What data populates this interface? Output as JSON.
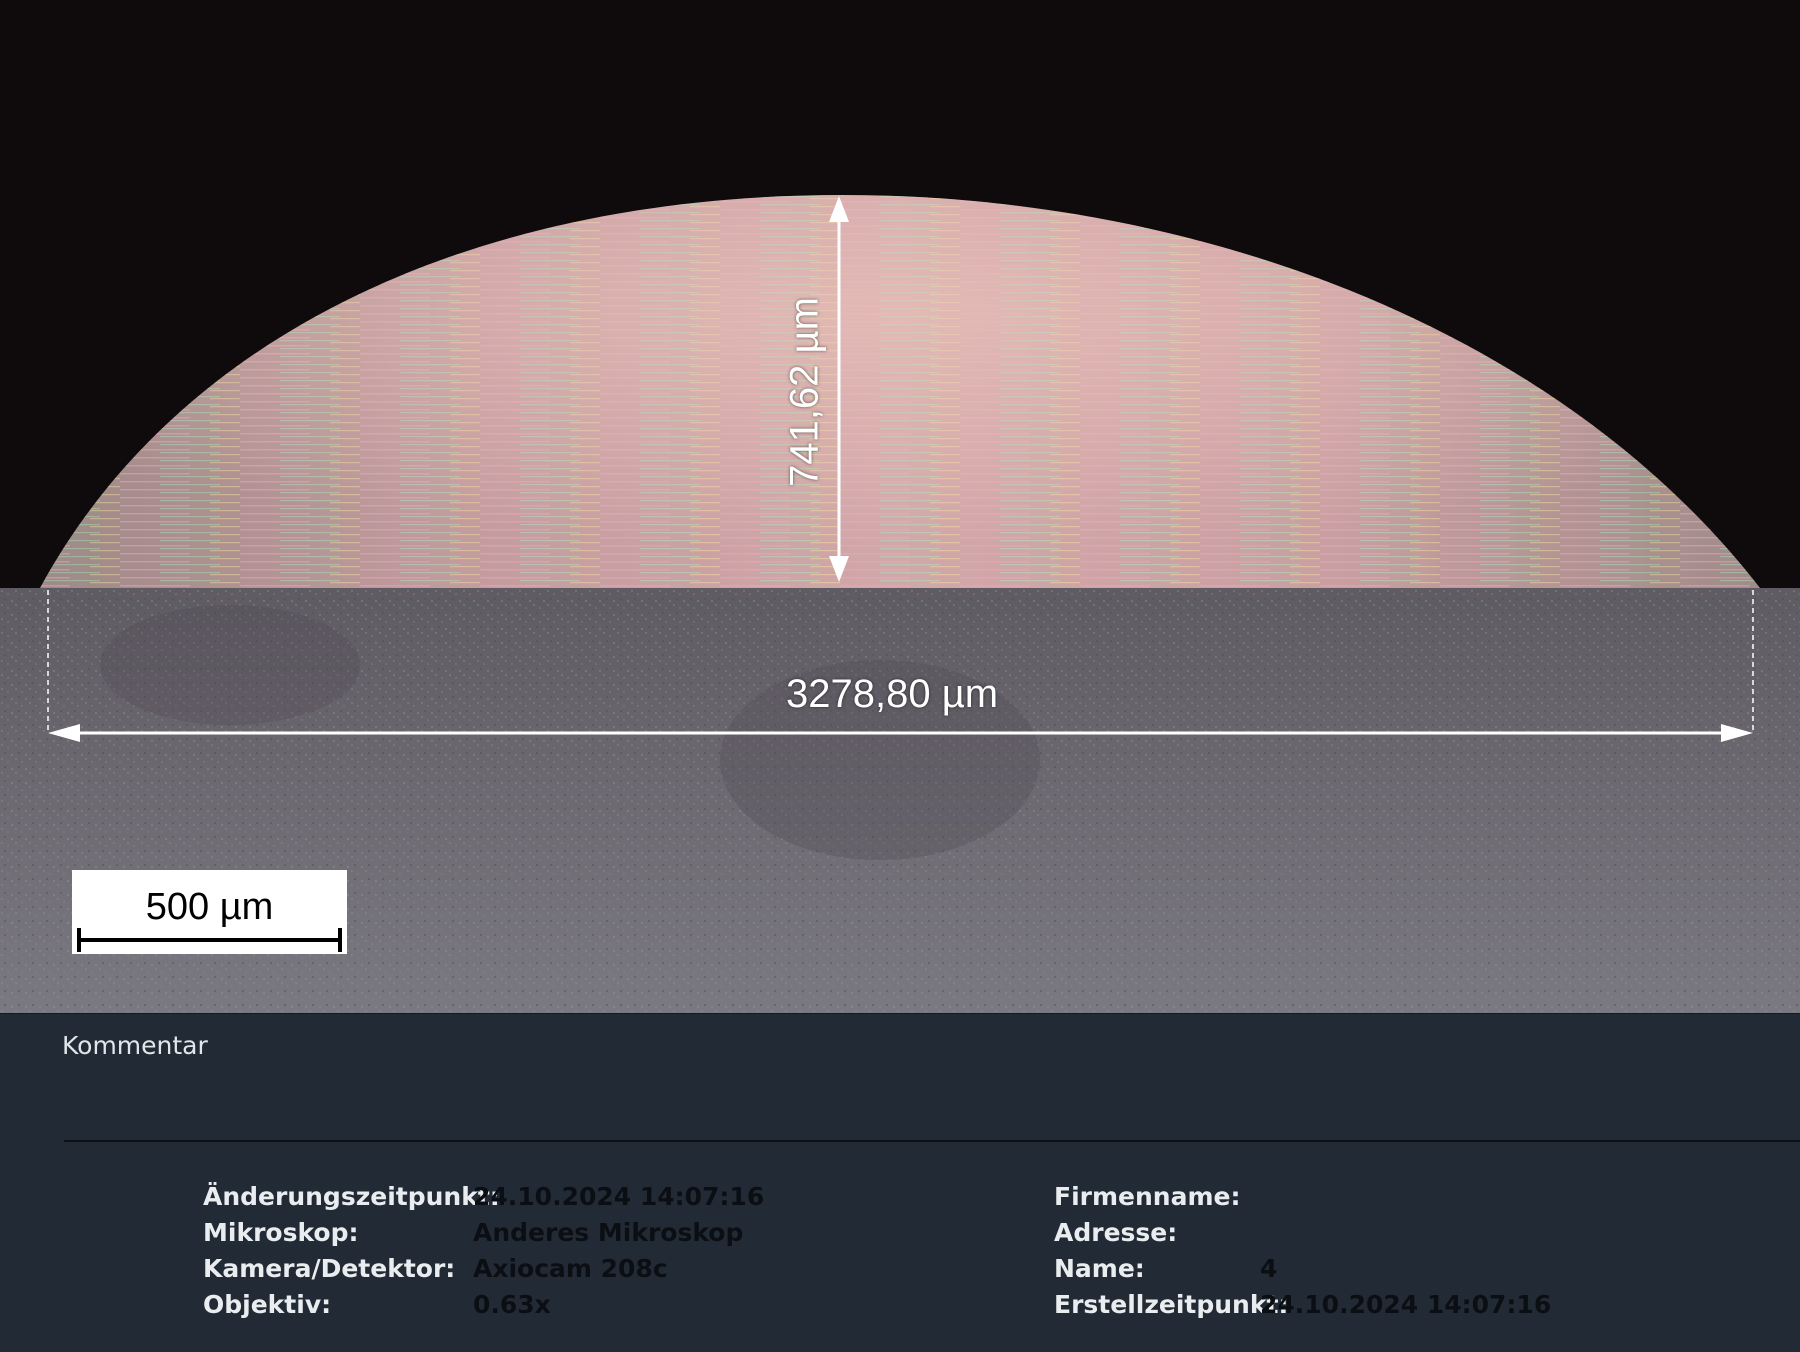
{
  "image_view": {
    "measurements": {
      "width": "3278,80 µm",
      "height": "741,62 µm"
    },
    "scale_bar": {
      "label": "500 µm"
    }
  },
  "comment_panel": {
    "label": "Kommentar"
  },
  "metadata": {
    "left": [
      {
        "key": "Änderungszeitpunkt:",
        "value": "24.10.2024 14:07:16"
      },
      {
        "key": "Mikroskop:",
        "value": "Anderes Mikroskop"
      },
      {
        "key": "Kamera/Detektor:",
        "value": "Axiocam 208c"
      },
      {
        "key": "Objektiv:",
        "value": "0.63x"
      }
    ],
    "right": [
      {
        "key": "Firmenname:",
        "value": ""
      },
      {
        "key": "Adresse:",
        "value": ""
      },
      {
        "key": "Name:",
        "value": "4"
      },
      {
        "key": "Erstellzeitpunkt:",
        "value": "24.10.2024 14:07:16"
      }
    ]
  },
  "colors": {
    "background_top": "#0f0b0d",
    "panel": "#222b35",
    "annotation": "#ffffff"
  }
}
